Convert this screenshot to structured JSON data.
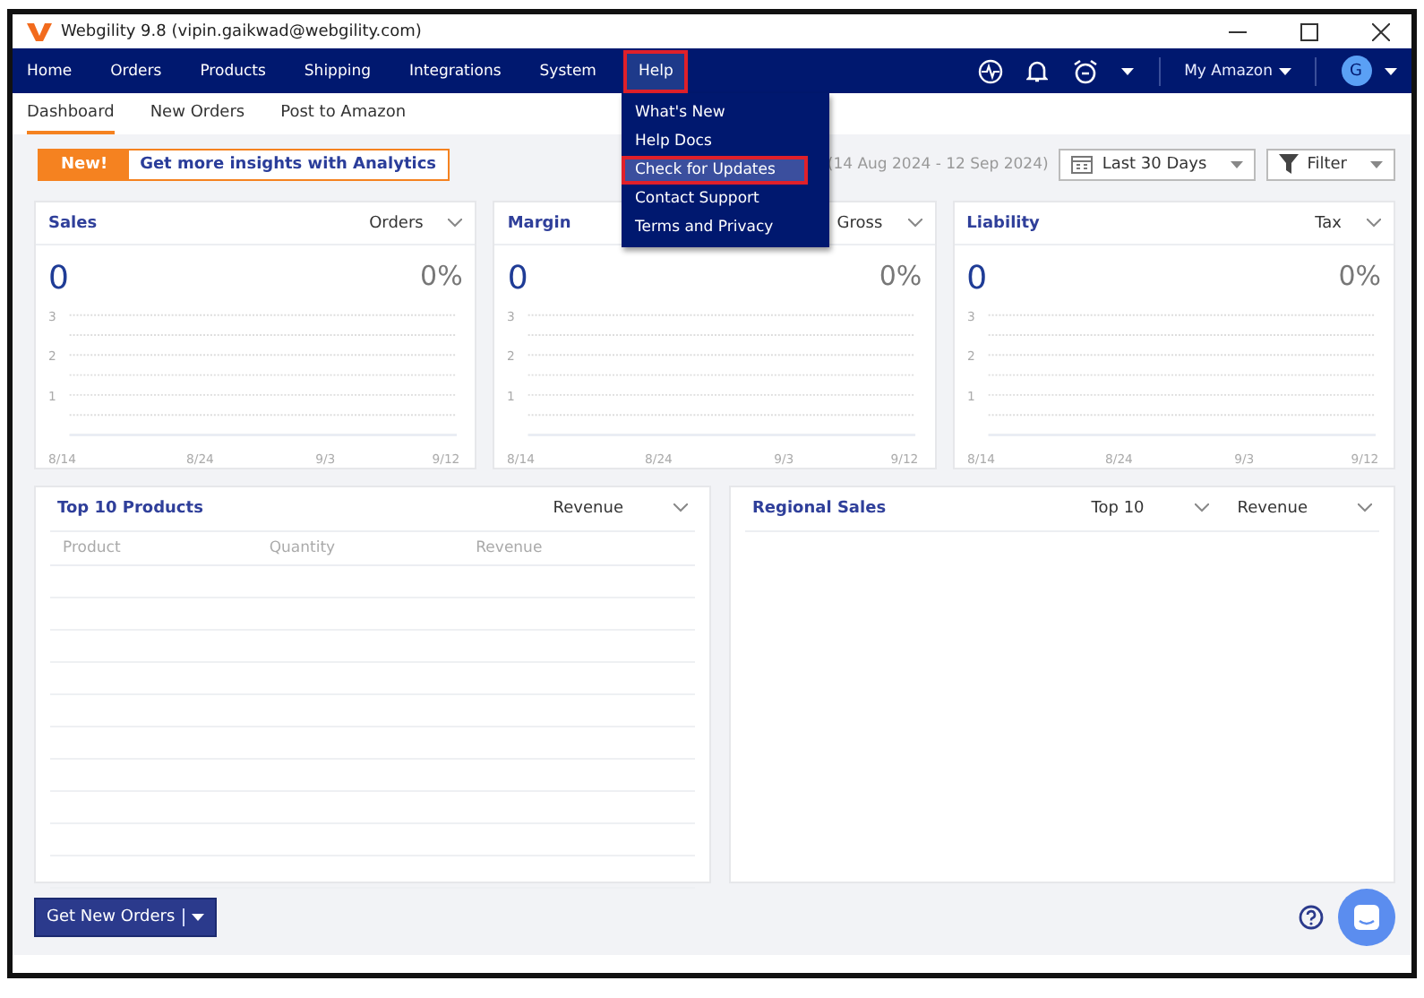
{
  "window": {
    "title": "Webgility 9.8 (vipin.gaikwad@webgility.com)"
  },
  "nav": {
    "items": [
      {
        "label": "Home",
        "selected": false
      },
      {
        "label": "Orders",
        "selected": false
      },
      {
        "label": "Products",
        "selected": false
      },
      {
        "label": "Shipping",
        "selected": false
      },
      {
        "label": "Integrations",
        "selected": false
      },
      {
        "label": "System",
        "selected": false
      },
      {
        "label": "Help",
        "selected": true
      }
    ],
    "account": "My Amazon",
    "avatar": "G"
  },
  "help_menu": {
    "items": [
      {
        "label": "What's New",
        "selected": false
      },
      {
        "label": "Help Docs",
        "selected": false
      },
      {
        "label": "Check for Updates",
        "selected": true
      },
      {
        "label": "Contact Support",
        "selected": false
      },
      {
        "label": "Terms and Privacy",
        "selected": false
      }
    ]
  },
  "subtabs": [
    {
      "label": "Dashboard",
      "selected": true
    },
    {
      "label": "New Orders",
      "selected": false
    },
    {
      "label": "Post to Amazon",
      "selected": false
    }
  ],
  "banner": {
    "badge": "New!",
    "text": "Get more insights with Analytics"
  },
  "date_range": "(14 Aug 2024 - 12 Sep 2024)",
  "period_dropdown": "Last 30 Days",
  "filter_button": "Filter",
  "cards": [
    {
      "title": "Sales",
      "metric": "Orders",
      "value": "0",
      "change": "0%",
      "chart_data": {
        "type": "line",
        "categories": [
          "8/14",
          "8/24",
          "9/3",
          "9/12"
        ],
        "ylim": [
          0,
          3
        ],
        "yticks": [
          1,
          2,
          3
        ],
        "series": [
          {
            "values": [
              0,
              0,
              0,
              0
            ]
          }
        ]
      }
    },
    {
      "title": "Margin",
      "metric": "Gross",
      "value": "0",
      "change": "0%",
      "chart_data": {
        "type": "line",
        "categories": [
          "8/14",
          "8/24",
          "9/3",
          "9/12"
        ],
        "ylim": [
          0,
          3
        ],
        "yticks": [
          1,
          2,
          3
        ],
        "series": [
          {
            "values": [
              0,
              0,
              0,
              0
            ]
          }
        ]
      }
    },
    {
      "title": "Liability",
      "metric": "Tax",
      "value": "0",
      "change": "0%",
      "chart_data": {
        "type": "line",
        "categories": [
          "8/14",
          "8/24",
          "9/3",
          "9/12"
        ],
        "ylim": [
          0,
          3
        ],
        "yticks": [
          1,
          2,
          3
        ],
        "series": [
          {
            "values": [
              0,
              0,
              0,
              0
            ]
          }
        ]
      }
    }
  ],
  "top_products": {
    "title": "Top 10 Products",
    "metric": "Revenue",
    "columns": [
      "Product",
      "Quantity",
      "Revenue"
    ]
  },
  "regional_sales": {
    "title": "Regional Sales",
    "scope": "Top 10",
    "metric": "Revenue"
  },
  "footer": {
    "button": "Get New Orders"
  }
}
